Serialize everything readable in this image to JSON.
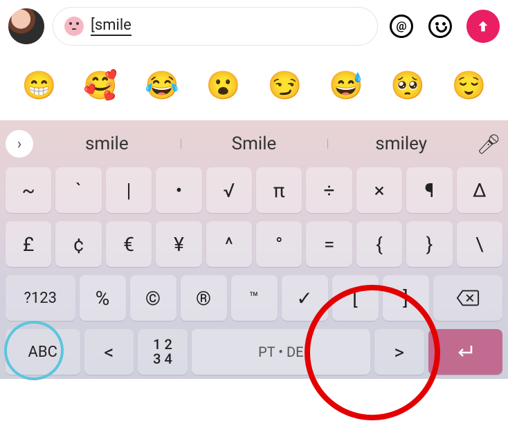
{
  "input": {
    "text": "[smile"
  },
  "emoji_suggestions": [
    "😁",
    "🥰",
    "😂",
    "😮",
    "😏",
    "😅",
    "🥺",
    "😌"
  ],
  "suggestions": [
    "smile",
    "Smile",
    "smiley"
  ],
  "keyboard": {
    "row1": [
      "~",
      "`",
      "|",
      "•",
      "√",
      "π",
      "÷",
      "×",
      "¶",
      "Δ"
    ],
    "row2": [
      "£",
      "¢",
      "€",
      "¥",
      "^",
      "°",
      "=",
      "{",
      "}",
      "\\"
    ],
    "row3": {
      "switch": "?123",
      "keys": [
        "%",
        "©",
        "®",
        "™",
        "✓",
        "[",
        "]"
      ]
    },
    "row4": {
      "abc": "ABC",
      "lt": "<",
      "num1": "1 2",
      "num2": "3 4",
      "space": "PT • DE",
      "gt": ">"
    }
  }
}
